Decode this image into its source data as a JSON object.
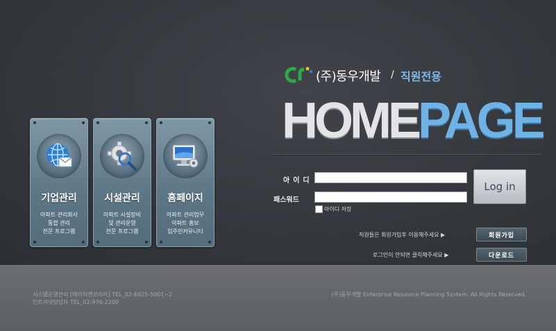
{
  "cards": [
    {
      "title": "기업관리",
      "desc": [
        "아파트 관리회사",
        "통합 관리",
        "전문 프로그램"
      ],
      "icon": "globe-envelope-icon"
    },
    {
      "title": "시설관리",
      "desc": [
        "아파트 시설장비",
        "및 관리운영",
        "전문 프로그램"
      ],
      "icon": "gear-magnifier-icon"
    },
    {
      "title": "홈페이지",
      "desc": [
        "아파트 관리업무",
        "아파트 홍보",
        "입주민커뮤니티"
      ],
      "icon": "monitor-gear-icon"
    }
  ],
  "logo": {
    "company": "(주)동우개발",
    "slash": "/",
    "staff": "직원전용"
  },
  "banner": {
    "home": "HOME",
    "page": "PAGE"
  },
  "login": {
    "id_label": "아이디",
    "pw_label": "패스워드",
    "id_value": "",
    "pw_value": "",
    "save_id": "아이디 저장",
    "button": "Log in"
  },
  "links": {
    "signup_hint": "직원들은 회원가입후 이용해주세요 ▶",
    "signup_button": "회원가입",
    "download_hint": "로그인이 안되면 클릭해주세요 ▶",
    "download_button": "다운로드"
  },
  "footer": {
    "line1": "시스템운영관리 [에이치엔코리아] TEL_02-6925-5001~2",
    "line2": "인트라넷담당자 TEL_02-976-2200",
    "copyright": "(주)동우개발 Enterprise Resource Planning System. All Rights Reserved."
  },
  "colors": {
    "accent_blue": "#6fb2e6",
    "background": "#34383d",
    "card": "#6a8292"
  }
}
